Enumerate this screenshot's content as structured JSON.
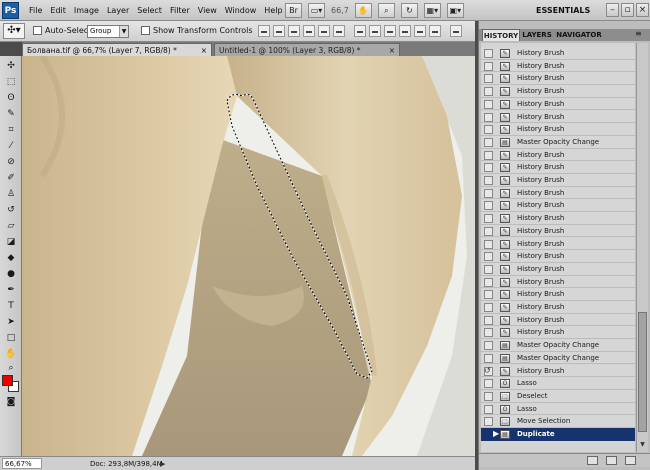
{
  "app": {
    "logo": "Ps"
  },
  "menu": [
    "File",
    "Edit",
    "Image",
    "Layer",
    "Select",
    "Filter",
    "View",
    "Window",
    "Help"
  ],
  "menubar_tools": {
    "zoom_value": "66,7",
    "workspace": "ESSENTIALS"
  },
  "options_bar": {
    "auto_select_label": "Auto-Select:",
    "auto_select_value": "Group",
    "show_transform_label": "Show Transform Controls"
  },
  "tabs": [
    {
      "label": "Болвана.tif @ 66,7% (Layer 7, RGB/8) *",
      "close": "×"
    },
    {
      "label": "Untitled-1 @ 100% (Layer 3, RGB/8) *",
      "close": "×"
    }
  ],
  "status": {
    "zoom": "66,67%",
    "doc": "Doc: 293,8M/398,4M"
  },
  "panel": {
    "tabs": [
      "HISTORY",
      "LAYERS",
      "NAVIGATOR"
    ],
    "history": [
      {
        "label": "History Brush",
        "icon": "history-brush-icon",
        "state": ""
      },
      {
        "label": "History Brush",
        "icon": "history-brush-icon",
        "state": ""
      },
      {
        "label": "History Brush",
        "icon": "history-brush-icon",
        "state": ""
      },
      {
        "label": "History Brush",
        "icon": "history-brush-icon",
        "state": ""
      },
      {
        "label": "History Brush",
        "icon": "history-brush-icon",
        "state": ""
      },
      {
        "label": "History Brush",
        "icon": "history-brush-icon",
        "state": ""
      },
      {
        "label": "History Brush",
        "icon": "history-brush-icon",
        "state": ""
      },
      {
        "label": "Master Opacity Change",
        "icon": "layer-icon",
        "state": ""
      },
      {
        "label": "History Brush",
        "icon": "history-brush-icon",
        "state": ""
      },
      {
        "label": "History Brush",
        "icon": "history-brush-icon",
        "state": ""
      },
      {
        "label": "History Brush",
        "icon": "history-brush-icon",
        "state": ""
      },
      {
        "label": "History Brush",
        "icon": "history-brush-icon",
        "state": ""
      },
      {
        "label": "History Brush",
        "icon": "history-brush-icon",
        "state": ""
      },
      {
        "label": "History Brush",
        "icon": "history-brush-icon",
        "state": ""
      },
      {
        "label": "History Brush",
        "icon": "history-brush-icon",
        "state": ""
      },
      {
        "label": "History Brush",
        "icon": "history-brush-icon",
        "state": ""
      },
      {
        "label": "History Brush",
        "icon": "history-brush-icon",
        "state": ""
      },
      {
        "label": "History Brush",
        "icon": "history-brush-icon",
        "state": ""
      },
      {
        "label": "History Brush",
        "icon": "history-brush-icon",
        "state": ""
      },
      {
        "label": "History Brush",
        "icon": "history-brush-icon",
        "state": ""
      },
      {
        "label": "History Brush",
        "icon": "history-brush-icon",
        "state": ""
      },
      {
        "label": "History Brush",
        "icon": "history-brush-icon",
        "state": ""
      },
      {
        "label": "History Brush",
        "icon": "history-brush-icon",
        "state": ""
      },
      {
        "label": "Master Opacity Change",
        "icon": "layer-icon",
        "state": ""
      },
      {
        "label": "Master Opacity Change",
        "icon": "layer-icon",
        "state": ""
      },
      {
        "label": "History Brush",
        "icon": "history-brush-icon",
        "state": "source"
      },
      {
        "label": "Lasso",
        "icon": "lasso-icon",
        "state": ""
      },
      {
        "label": "Deselect",
        "icon": "marquee-icon",
        "state": ""
      },
      {
        "label": "Lasso",
        "icon": "lasso-icon",
        "state": ""
      },
      {
        "label": "Move Selection",
        "icon": "marquee-icon",
        "state": ""
      },
      {
        "label": "Duplicate",
        "icon": "layer-icon",
        "state": "selected"
      }
    ]
  }
}
